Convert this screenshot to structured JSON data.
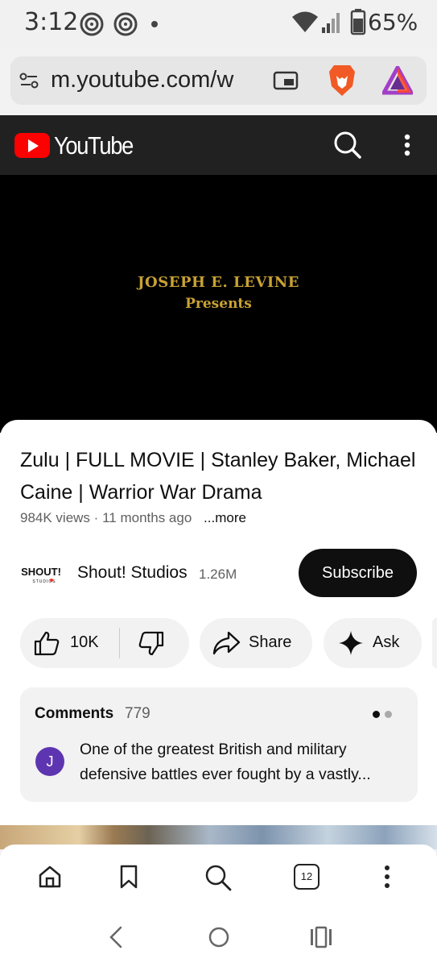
{
  "status_bar": {
    "time": "3:12",
    "battery": "65%",
    "icons": [
      "at-sign-icon",
      "at-sign-icon",
      "dot-icon",
      "wifi-icon",
      "signal-icon",
      "battery-icon"
    ]
  },
  "browser": {
    "url": "m.youtube.com/w",
    "tab_count": "12",
    "icons": [
      "site-settings-icon",
      "picture-in-picture-icon",
      "brave-lion-icon",
      "brave-rewards-icon"
    ]
  },
  "youtube_header": {
    "logo_text": "YouTube",
    "icons": [
      "search-icon",
      "more-vert-icon"
    ]
  },
  "video": {
    "overlay_line1": "JOSEPH E. LEVINE",
    "overlay_line2": "Presents"
  },
  "details": {
    "title": "Zulu | FULL MOVIE | Stanley Baker, Michael Caine | Warrior War Drama",
    "views": "984K views",
    "separator": "·",
    "age": "11 months ago",
    "more": "...more"
  },
  "channel": {
    "logo_text": "SHOUT!",
    "logo_subtext": "STUDIOS",
    "name": "Shout! Studios",
    "subscribers": "1.26M",
    "subscribe_label": "Subscribe"
  },
  "actions": {
    "like_count": "10K",
    "share_label": "Share",
    "ask_label": "Ask"
  },
  "comments": {
    "label": "Comments",
    "count": "779",
    "avatar_initial": "J",
    "top_comment": "One of the greatest British and military defensive battles ever fought by a vastly..."
  },
  "colors": {
    "youtube_red": "#ff0000",
    "header_bg": "#212121",
    "title_gold": "#c8a234",
    "avatar_purple": "#5e35b1"
  }
}
